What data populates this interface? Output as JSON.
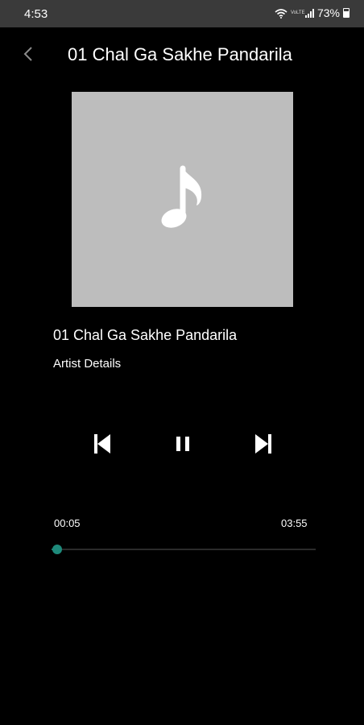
{
  "status_bar": {
    "time": "4:53",
    "volte_label": "VoLTE",
    "battery": "73%",
    "icons": [
      "wifi-icon",
      "signal-icon",
      "battery-icon"
    ]
  },
  "header": {
    "title": "01 Chal Ga Sakhe Pandarila",
    "back_icon": "chevron-left-icon"
  },
  "album_art": {
    "icon": "music-note-icon"
  },
  "track": {
    "title": "01 Chal Ga Sakhe Pandarila",
    "artist": "Artist Details"
  },
  "controls": {
    "prev_icon": "skip-previous-icon",
    "pause_icon": "pause-icon",
    "next_icon": "skip-next-icon"
  },
  "progress": {
    "current": "00:05",
    "total": "03:55",
    "fraction": 0.021
  },
  "colors": {
    "background": "#000000",
    "status_bar": "#3a3a3a",
    "album_placeholder": "#bdbdbd",
    "accent": "#1e8a7b"
  }
}
